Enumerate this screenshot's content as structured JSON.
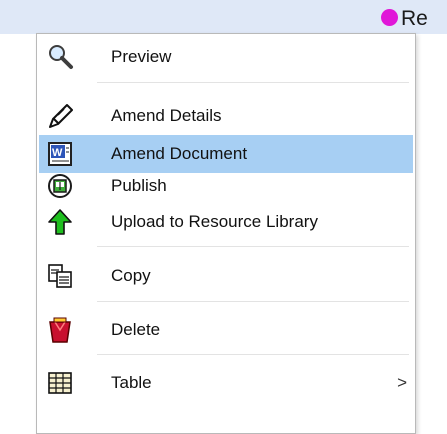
{
  "header": {
    "label": "Re",
    "dot_color": "#e017d8"
  },
  "menu": {
    "highlight_color": "#a7cff3",
    "items": [
      {
        "label": "Preview",
        "icon": "magnifier-icon"
      },
      {
        "label": "Amend Details",
        "icon": "pencil-icon"
      },
      {
        "label": "Amend Document",
        "icon": "word-document-icon",
        "highlighted": true
      },
      {
        "label": "Publish",
        "icon": "publish-icon"
      },
      {
        "label": "Upload to Resource Library",
        "icon": "up-arrow-icon"
      },
      {
        "label": "Copy",
        "icon": "copy-icon"
      },
      {
        "label": "Delete",
        "icon": "trash-icon"
      },
      {
        "label": "Table",
        "icon": "table-icon",
        "submenu_arrow": ">"
      }
    ]
  }
}
